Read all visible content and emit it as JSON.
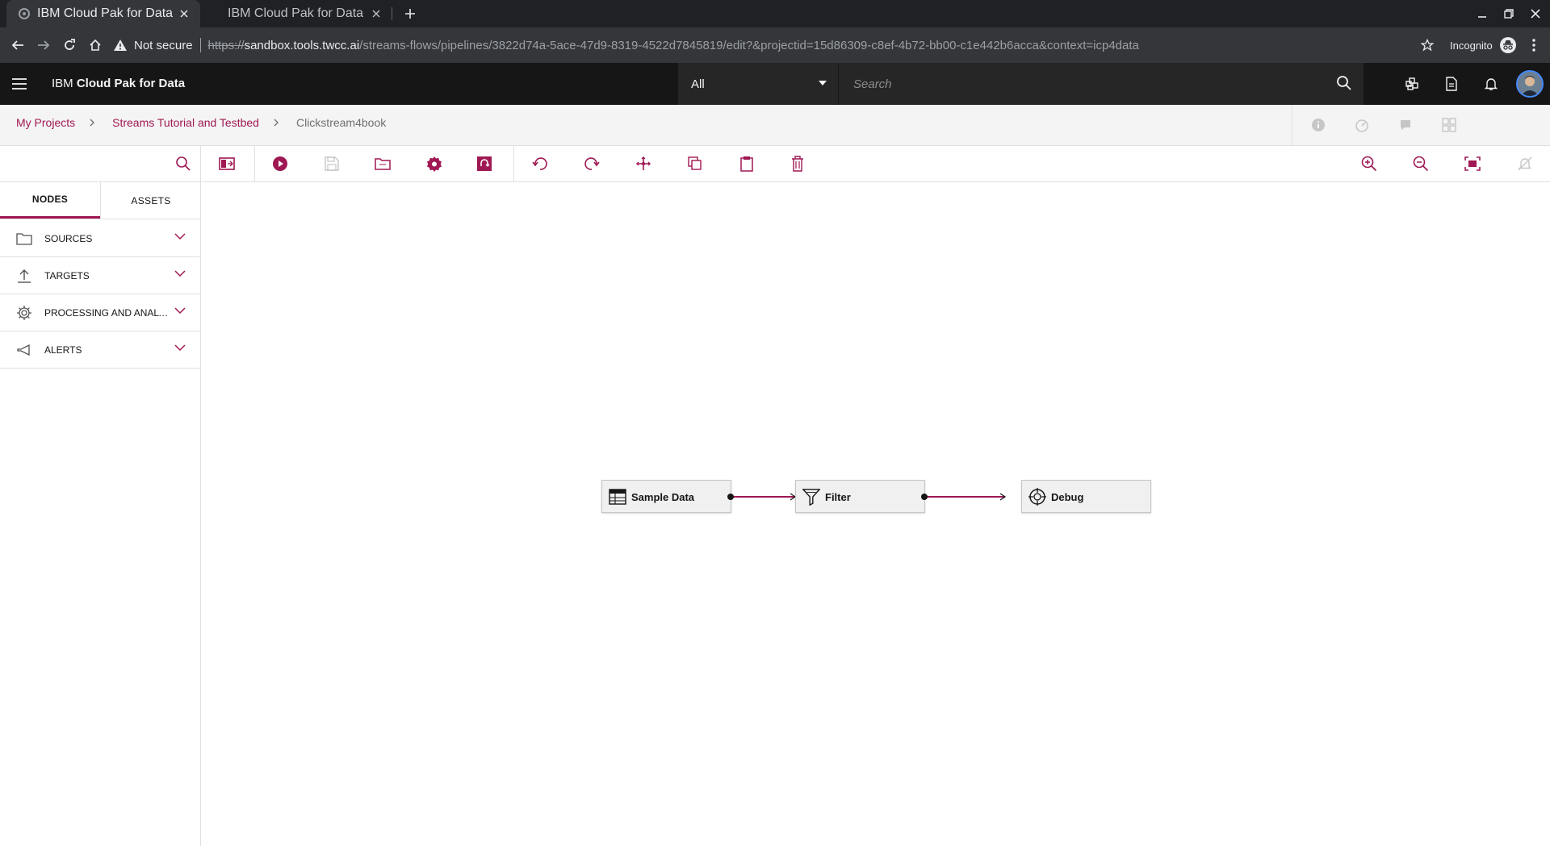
{
  "browser": {
    "tabs": [
      {
        "title": "IBM Cloud Pak for Data",
        "active": true
      },
      {
        "title": "IBM Cloud Pak for Data",
        "active": false
      }
    ],
    "security_label": "Not secure",
    "url": {
      "scheme": "https://",
      "host": "sandbox.tools.twcc.ai",
      "path": "/streams-flows/pipelines/3822d74a-5ace-47d9-8319-4522d7845819/edit?&projectid=15d86309-c8ef-4b72-bb00-c1e442b6acca&context=icp4data"
    },
    "incognito_label": "Incognito"
  },
  "app": {
    "brand_prefix": "IBM ",
    "brand_name": "Cloud Pak for Data",
    "scope_selected": "All",
    "search_placeholder": "Search"
  },
  "breadcrumb": {
    "items": [
      "My Projects",
      "Streams Tutorial and Testbed"
    ],
    "current": "Clickstream4book"
  },
  "palette": {
    "tabs": [
      "NODES",
      "ASSETS"
    ],
    "categories": [
      {
        "label": "SOURCES",
        "icon": "folder-icon"
      },
      {
        "label": "TARGETS",
        "icon": "upload-icon"
      },
      {
        "label": "PROCESSING AND ANALYTICS",
        "icon": "gear-icon"
      },
      {
        "label": "ALERTS",
        "icon": "megaphone-icon"
      }
    ]
  },
  "canvas": {
    "nodes": [
      {
        "label": "Sample Data",
        "icon": "sample-data-icon"
      },
      {
        "label": "Filter",
        "icon": "filter-icon"
      },
      {
        "label": "Debug",
        "icon": "debug-icon"
      }
    ]
  },
  "colors": {
    "accent": "#9f1853",
    "header_bg": "#161616",
    "chrome_bg": "#202124"
  }
}
